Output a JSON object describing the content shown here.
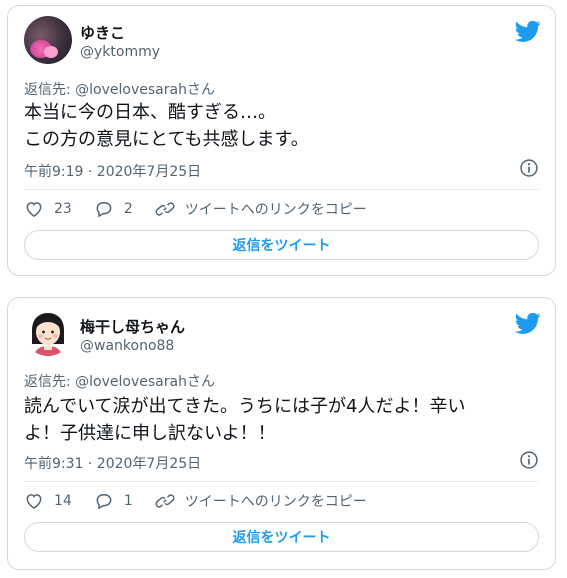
{
  "colors": {
    "accent": "#1d9bf0",
    "muted": "#536471",
    "text": "#0f1419",
    "border": "#cfd9de"
  },
  "icons": {
    "brand": "twitter-bird-icon",
    "like": "heart-icon",
    "reply": "speech-bubble-icon",
    "copy": "link-icon",
    "info": "info-icon"
  },
  "tweets": [
    {
      "display_name": "ゆきこ",
      "handle": "@yktommy",
      "reply_to": "返信先: @lovelovesarahさん",
      "text_line1": "本当に今の日本、酷すぎる…。",
      "text_line2": "この方の意見にとても共感します。",
      "timestamp": "午前9:19 · 2020年7月25日",
      "likes": "23",
      "replies": "2",
      "copy_link_label": "ツイートへのリンクをコピー",
      "reply_button_label": "返信をツイート"
    },
    {
      "display_name": "梅干し母ちゃん",
      "handle": "@wankono88",
      "reply_to": "返信先: @lovelovesarahさん",
      "text_line1": "読んでいて涙が出てきた。うちには子が4人だよ！辛い",
      "text_line2": "よ！子供達に申し訳ないよ！！",
      "timestamp": "午前9:31 · 2020年7月25日",
      "likes": "14",
      "replies": "1",
      "copy_link_label": "ツイートへのリンクをコピー",
      "reply_button_label": "返信をツイート"
    }
  ]
}
